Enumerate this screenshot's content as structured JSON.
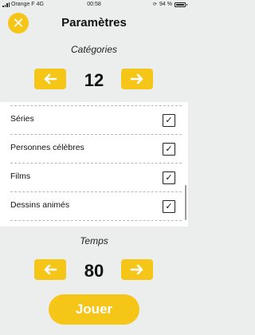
{
  "status_bar": {
    "carrier": "Orange F",
    "network": "4G",
    "time": "00:58",
    "battery": "94 %",
    "icons": [
      "signal-icon",
      "orientation-lock-icon",
      "battery-icon"
    ]
  },
  "header": {
    "close_icon": "✕",
    "title": "Paramètres"
  },
  "categories": {
    "title": "Catégories",
    "value": "12",
    "items": [
      {
        "label": "Séries",
        "checked": true
      },
      {
        "label": "Personnes célèbres",
        "checked": true
      },
      {
        "label": "Films",
        "checked": true
      },
      {
        "label": "Dessins animés",
        "checked": true
      }
    ]
  },
  "time": {
    "title": "Temps",
    "value": "80"
  },
  "play_button": "Jouer",
  "colors": {
    "accent": "#f5c518",
    "background": "#eceeee",
    "panel": "#ffffff"
  }
}
